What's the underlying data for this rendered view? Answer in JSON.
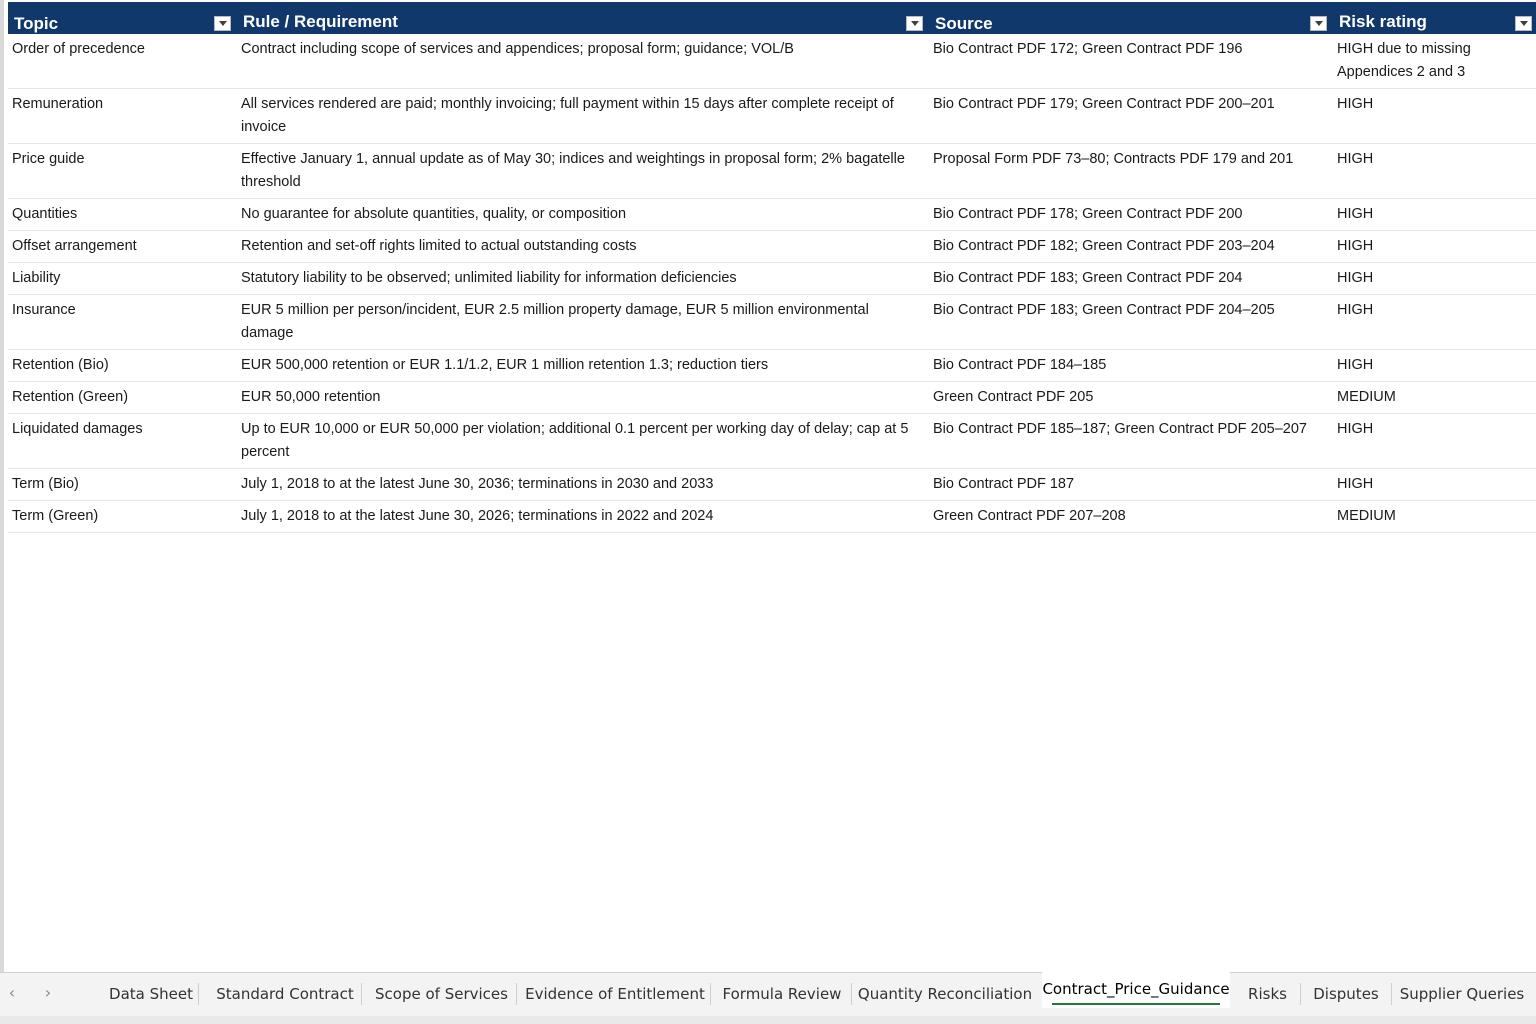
{
  "table": {
    "headers": [
      "Topic",
      "Rule / Requirement",
      "Source",
      "Risk rating"
    ],
    "rows": [
      [
        "Order of precedence",
        "Contract including scope of services and appendices; proposal form; guidance; VOL/B",
        "Bio Contract PDF 172; Green Contract PDF 196",
        "HIGH due to missing Appendices 2 and 3"
      ],
      [
        "Remuneration",
        "All services rendered are paid; monthly invoicing; full payment within 15 days after complete receipt of invoice",
        "Bio Contract PDF 179; Green Contract PDF 200–201",
        "HIGH"
      ],
      [
        "Price guide",
        "Effective January 1, annual update as of May 30; indices and weightings in proposal form; 2% bagatelle threshold",
        "Proposal Form PDF 73–80; Contracts PDF 179 and 201",
        "HIGH"
      ],
      [
        "Quantities",
        "No guarantee for absolute quantities, quality, or composition",
        "Bio Contract PDF 178; Green Contract PDF 200",
        "HIGH"
      ],
      [
        "Offset arrangement",
        "Retention and set-off rights limited to actual outstanding costs",
        "Bio Contract PDF 182; Green Contract PDF 203–204",
        "HIGH"
      ],
      [
        "Liability",
        "Statutory liability to be observed; unlimited liability for information deficiencies",
        "Bio Contract PDF 183; Green Contract PDF 204",
        "HIGH"
      ],
      [
        "Insurance",
        "EUR 5 million per person/incident, EUR 2.5 million property damage, EUR 5 million environmental damage",
        "Bio Contract PDF 183; Green Contract PDF 204–205",
        "HIGH"
      ],
      [
        "Retention (Bio)",
        "EUR 500,000 retention or EUR 1.1/1.2, EUR 1 million retention 1.3; reduction tiers",
        "Bio Contract PDF 184–185",
        "HIGH"
      ],
      [
        "Retention (Green)",
        "EUR 50,000 retention",
        "Green Contract PDF 205",
        "MEDIUM"
      ],
      [
        "Liquidated damages",
        "Up to EUR 10,000 or EUR 50,000 per violation; additional 0.1 percent per working day of delay; cap at 5 percent",
        "Bio Contract PDF 185–187; Green Contract PDF 205–207",
        "HIGH"
      ],
      [
        "Term (Bio)",
        "July 1, 2018 to at the latest June 30, 2036; terminations in 2030 and 2033",
        "Bio Contract PDF 187",
        "HIGH"
      ],
      [
        "Term (Green)",
        "July 1, 2018 to at the latest June 30, 2026; terminations in 2022 and 2024",
        "Green Contract PDF 207–208",
        "MEDIUM"
      ]
    ]
  },
  "tabs": [
    {
      "label": "Data Sheet"
    },
    {
      "label": "Standard Contract"
    },
    {
      "label": "Scope of Services"
    },
    {
      "label": "Evidence of Entitlement"
    },
    {
      "label": "Formula Review"
    },
    {
      "label": "Quantity Reconciliation"
    },
    {
      "label": "Contract_Price_Guidance",
      "active": true
    },
    {
      "label": "Risks"
    },
    {
      "label": "Disputes"
    },
    {
      "label": "Supplier Queries"
    }
  ],
  "nav": {
    "prev": "‹",
    "next": "›"
  },
  "colors": {
    "header_bg": "#10386b",
    "active_tab_underline": "#1f7a3a"
  }
}
